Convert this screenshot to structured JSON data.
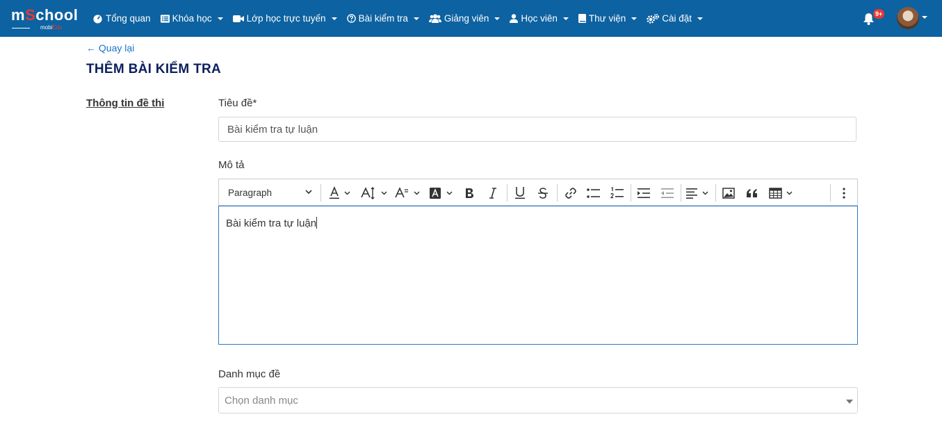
{
  "brand": {
    "name_pre": "m",
    "name_o": "S",
    "name_post": "chool",
    "sub_pre": "mobi",
    "sub_post": "Edu"
  },
  "nav": [
    {
      "label": "Tổng quan",
      "icon": "dashboard-icon",
      "dropdown": false
    },
    {
      "label": "Khóa học",
      "icon": "list-icon",
      "dropdown": true
    },
    {
      "label": "Lớp học trực tuyến",
      "icon": "video-icon",
      "dropdown": true
    },
    {
      "label": "Bài kiểm tra",
      "icon": "question-icon",
      "dropdown": true
    },
    {
      "label": "Giảng viên",
      "icon": "users-icon",
      "dropdown": true
    },
    {
      "label": "Học viên",
      "icon": "user-icon",
      "dropdown": true
    },
    {
      "label": "Thư viện",
      "icon": "book-icon",
      "dropdown": true
    },
    {
      "label": "Cài đặt",
      "icon": "gears-icon",
      "dropdown": true
    }
  ],
  "notifications": {
    "badge": "9+"
  },
  "page": {
    "back_label": "Quay lại",
    "title": "THÊM BÀI KIỂM TRA",
    "section_label": "Thông tin đề thi"
  },
  "form": {
    "title_label": "Tiêu đề*",
    "title_value": "Bài kiểm tra tự luận",
    "description_label": "Mô tả",
    "description_value": "Bài kiểm tra tự luận",
    "category_label": "Danh mục đề",
    "category_placeholder": "Chọn danh mục"
  },
  "editor": {
    "paragraph_label": "Paragraph",
    "tools": [
      "font-color-icon",
      "font-size-icon",
      "font-family-icon",
      "highlight-icon",
      "bold-icon",
      "italic-icon",
      "underline-icon",
      "strikethrough-icon",
      "link-icon",
      "bulleted-list-icon",
      "numbered-list-icon",
      "indent-icon",
      "outdent-icon",
      "align-icon",
      "image-icon",
      "blockquote-icon",
      "table-icon",
      "more-icon"
    ]
  },
  "colors": {
    "header": "#0d62a1",
    "title": "#0b1f5c",
    "link": "#1a73c8",
    "badge": "#e53935",
    "editor_focus": "#2d78c4"
  }
}
